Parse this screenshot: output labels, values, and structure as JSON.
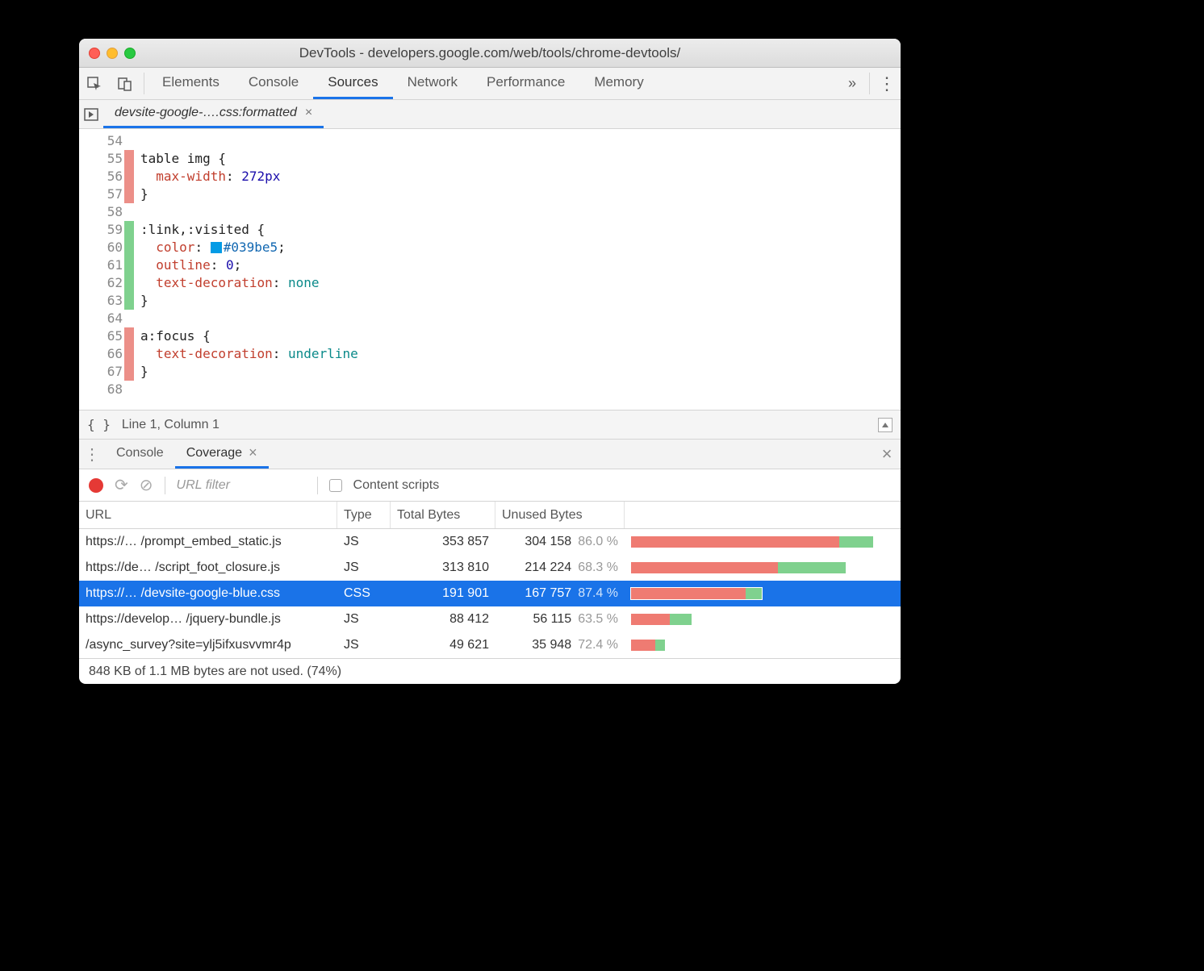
{
  "window_title": "DevTools - developers.google.com/web/tools/chrome-devtools/",
  "main_tabs": [
    "Elements",
    "Console",
    "Sources",
    "Network",
    "Performance",
    "Memory"
  ],
  "main_tab_active": "Sources",
  "file_tab": "devsite-google-….css:formatted",
  "code_lines": [
    {
      "n": 54,
      "cov": "",
      "html": ""
    },
    {
      "n": 55,
      "cov": "red",
      "html": "<span class='sel'>table img</span> {"
    },
    {
      "n": 56,
      "cov": "red",
      "html": "  <span class='prop'>max-width</span>: <span class='num'>272px</span>"
    },
    {
      "n": 57,
      "cov": "red",
      "html": "}"
    },
    {
      "n": 58,
      "cov": "",
      "html": ""
    },
    {
      "n": 59,
      "cov": "grn",
      "html": "<span class='sel'>:link</span>,<span class='sel'>:visited</span> {"
    },
    {
      "n": 60,
      "cov": "grn",
      "html": "  <span class='prop'>color</span>: <span class='swatch'></span><span class='val'>#039be5</span>;"
    },
    {
      "n": 61,
      "cov": "grn",
      "html": "  <span class='prop'>outline</span>: <span class='num'>0</span>;"
    },
    {
      "n": 62,
      "cov": "grn",
      "html": "  <span class='prop'>text-decoration</span>: <span class='kw'>none</span>"
    },
    {
      "n": 63,
      "cov": "grn",
      "html": "}"
    },
    {
      "n": 64,
      "cov": "",
      "html": ""
    },
    {
      "n": 65,
      "cov": "red",
      "html": "<span class='sel'>a:focus</span> {"
    },
    {
      "n": 66,
      "cov": "red",
      "html": "  <span class='prop'>text-decoration</span>: <span class='kw'>underline</span>"
    },
    {
      "n": 67,
      "cov": "red",
      "html": "}"
    },
    {
      "n": 68,
      "cov": "",
      "html": ""
    }
  ],
  "status_line": "Line 1, Column 1",
  "drawer_tabs": [
    {
      "label": "Console",
      "active": false,
      "closable": false
    },
    {
      "label": "Coverage",
      "active": true,
      "closable": true
    }
  ],
  "coverage_toolbar": {
    "url_filter_placeholder": "URL filter",
    "content_scripts_label": "Content scripts"
  },
  "coverage_columns": [
    "URL",
    "Type",
    "Total Bytes",
    "Unused Bytes"
  ],
  "coverage_rows": [
    {
      "url": "https://… /prompt_embed_static.js",
      "type": "JS",
      "total": "353 857",
      "unused": "304 158",
      "pct": "86.0 %",
      "bar_red": 258,
      "bar_grn": 42,
      "selected": false
    },
    {
      "url": "https://de… /script_foot_closure.js",
      "type": "JS",
      "total": "313 810",
      "unused": "214 224",
      "pct": "68.3 %",
      "bar_red": 182,
      "bar_grn": 84,
      "selected": false
    },
    {
      "url": "https://… /devsite-google-blue.css",
      "type": "CSS",
      "total": "191 901",
      "unused": "167 757",
      "pct": "87.4 %",
      "bar_red": 142,
      "bar_grn": 20,
      "selected": true
    },
    {
      "url": "https://develop… /jquery-bundle.js",
      "type": "JS",
      "total": "88 412",
      "unused": "56 115",
      "pct": "63.5 %",
      "bar_red": 48,
      "bar_grn": 27,
      "selected": false
    },
    {
      "url": "/async_survey?site=ylj5ifxusvvmr4p",
      "type": "JS",
      "total": "49 621",
      "unused": "35 948",
      "pct": "72.4 %",
      "bar_red": 30,
      "bar_grn": 12,
      "selected": false
    }
  ],
  "drawer_status": "848 KB of 1.1 MB bytes are not used. (74%)"
}
